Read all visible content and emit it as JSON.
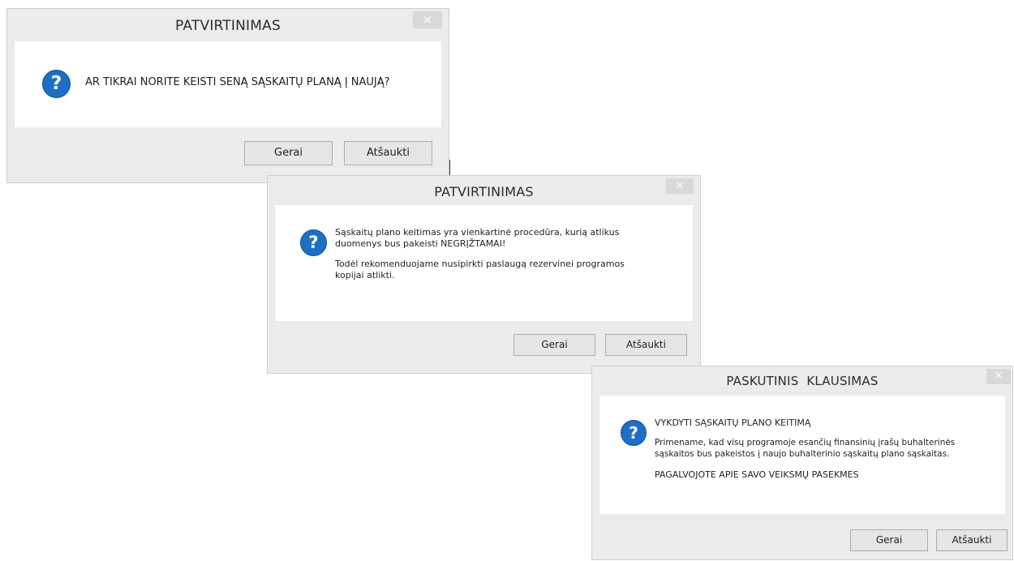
{
  "dialog1": {
    "title": "PATVIRTINIMAS",
    "close_glyph": "×",
    "icon": "question-icon",
    "icon_glyph": "?",
    "message": "AR TIKRAI NORITE KEISTI SENĄ SĄSKAITŲ PLANĄ Į NAUJĄ?",
    "ok_label": "Gerai",
    "cancel_label": "Atšaukti"
  },
  "dialog2": {
    "title": "PATVIRTINIMAS",
    "close_glyph": "×",
    "icon": "question-icon",
    "icon_glyph": "?",
    "paragraph1_line1": "Sąskaitų plano keitimas yra vienkartinė procedūra, kurią atlikus",
    "paragraph1_line2": "duomenys bus pakeisti NEGRĮŽTAMAI!",
    "paragraph2_line1": "Todėl rekomenduojame nusipirkti paslaugą rezervinei programos",
    "paragraph2_line2": "kopijai atlikti.",
    "ok_label": "Gerai",
    "cancel_label": "Atšaukti"
  },
  "dialog3": {
    "title": "PASKUTINIS  KLAUSIMAS",
    "close_glyph": "×",
    "icon": "question-icon",
    "icon_glyph": "?",
    "heading": "VYKDYTI SĄSKAITŲ PLANO KEITIMĄ",
    "reminder_line1": "Primename, kad visų programoje esančių finansinių įrašų buhalterinės",
    "reminder_line2": "sąskaitos bus pakeistos į naujo buhalterinio sąskaitų plano sąskaitas.",
    "warning": "PAGALVOJOTE APIE SAVO VEIKSMŲ PASEKMES",
    "ok_label": "Gerai",
    "cancel_label": "Atšaukti"
  },
  "colors": {
    "frame": "#ececec",
    "content": "#ffffff",
    "icon_blue": "#1c6fc4",
    "close_button": "#d9d9d9"
  }
}
